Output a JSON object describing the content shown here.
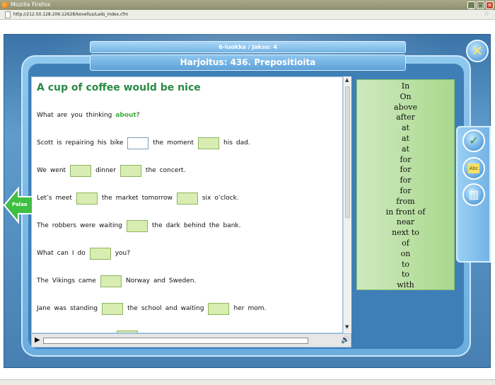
{
  "window": {
    "title": "Mozilla Firefox",
    "minimize": "_",
    "maximize": "□",
    "close": "✕"
  },
  "address": {
    "url": "http://212.50.128.206:12628/kovellus/Lads_index.cfm"
  },
  "header": {
    "subtitle": "6-luokka / Jakso: 4",
    "title": "Harjoitus: 436. Prepositioita",
    "close_glyph": "✕"
  },
  "exercise": {
    "heading": "A cup of coffee would be nice",
    "rows": [
      {
        "parts": [
          "What",
          "are",
          "you",
          "thinking"
        ],
        "filled": "about",
        "tail": "?"
      },
      {
        "parts": [
          "Scott",
          "is",
          "repairing",
          "his",
          "bike"
        ],
        "p2": [
          "the",
          "moment"
        ],
        "p3": [
          "his",
          "dad."
        ]
      },
      {
        "parts": [
          "We",
          "went"
        ],
        "p2": [
          "dinner"
        ],
        "p3": [
          "the",
          "concert."
        ]
      },
      {
        "parts": [
          "Let’s",
          "meet"
        ],
        "p2": [
          "the",
          "market",
          "tomorrow"
        ],
        "p3": [
          "six",
          "o’clock."
        ]
      },
      {
        "parts": [
          "The",
          "robbers",
          "were",
          "waiting"
        ],
        "p2": [
          "the",
          "dark",
          "behind",
          "the",
          "bank."
        ]
      },
      {
        "parts": [
          "What",
          "can",
          "I",
          "do"
        ],
        "p2": [
          "you?"
        ]
      },
      {
        "parts": [
          "The",
          "Vikings",
          "came"
        ],
        "p2": [
          "Norway",
          "and",
          "Sweden."
        ]
      },
      {
        "parts": [
          "Jane",
          "was",
          "standing"
        ],
        "p2": [
          "the",
          "school",
          "and",
          "waiting"
        ],
        "p3": [
          "her",
          "mom."
        ]
      }
    ]
  },
  "wordbank": [
    "In",
    "On",
    "above",
    "after",
    "at",
    "at",
    "at",
    "for",
    "for",
    "for",
    "for",
    "from",
    "in front of",
    "near",
    "next to",
    "of",
    "on",
    "to",
    "to",
    "with"
  ],
  "back": {
    "label": "Palaa"
  },
  "tools": [
    {
      "name": "check-icon",
      "glyph": "✓"
    },
    {
      "name": "abc-note-icon",
      "glyph": "Abc"
    },
    {
      "name": "book-icon",
      "glyph": "▥"
    }
  ],
  "player": {
    "play": "▶",
    "volume": "🔊"
  },
  "colors": {
    "accent": "#2a8a45",
    "gap_fill": "#d8edb2",
    "bank": "#a9d88c",
    "app_blue": "#3f7fb8"
  }
}
